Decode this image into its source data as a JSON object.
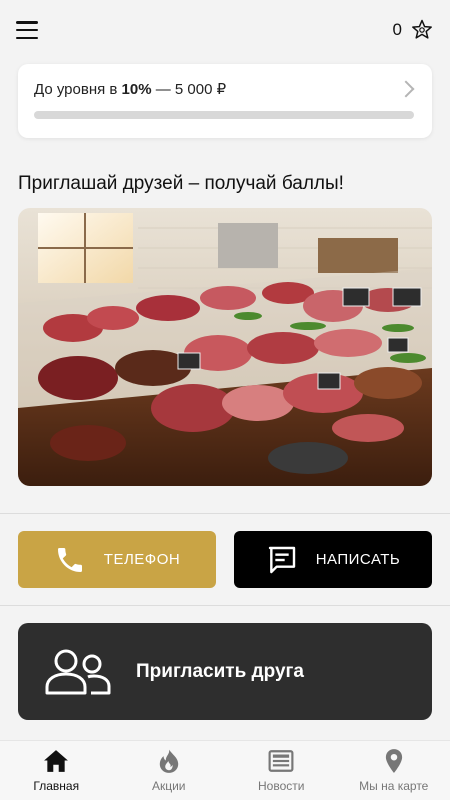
{
  "header": {
    "points_value": "0",
    "menu_icon": "hamburger-menu-icon",
    "points_icon": "star-badge-icon"
  },
  "level": {
    "prefix": "До уровня в ",
    "percent": "10%",
    "suffix": " — 5 000 ₽",
    "progress_fraction": 0.0
  },
  "invite": {
    "title": "Приглашай друзей – получай баллы!",
    "image_alt": "meat counter photo"
  },
  "actions": {
    "phone_label": "ТЕЛЕФОН",
    "write_label": "НАПИСАТЬ",
    "invite_friend_label": "Пригласить друга"
  },
  "colors": {
    "accent": "#c9a445",
    "dark": "#2e2e2e",
    "black": "#000000"
  },
  "nav": {
    "items": [
      {
        "label": "Главная",
        "icon": "home-icon",
        "active": true
      },
      {
        "label": "Акции",
        "icon": "flame-icon",
        "active": false
      },
      {
        "label": "Новости",
        "icon": "news-icon",
        "active": false
      },
      {
        "label": "Мы на карте",
        "icon": "map-pin-icon",
        "active": false
      }
    ]
  }
}
